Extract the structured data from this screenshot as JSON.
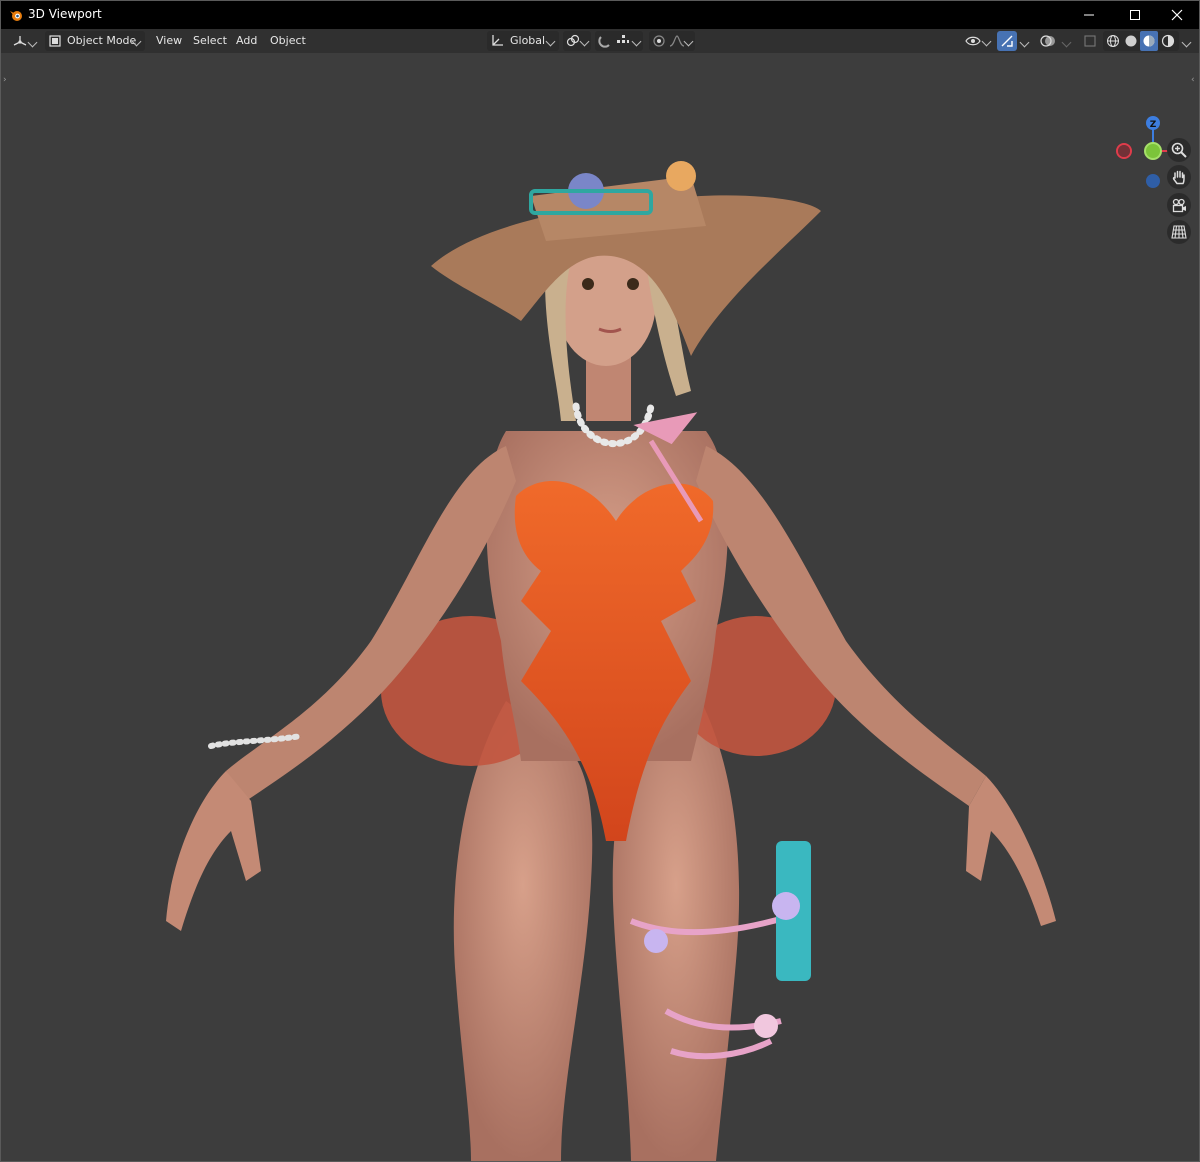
{
  "window": {
    "title": "3D Viewport",
    "controls": [
      "minimize",
      "maximize",
      "close"
    ]
  },
  "header": {
    "editor_type_icon": "viewport-editor-icon",
    "mode_label": "Object Mode",
    "menus": [
      "View",
      "Select",
      "Add",
      "Object"
    ],
    "transform_orientation": "Global",
    "right_icons": [
      "visibility-icon",
      "gizmo-icon",
      "overlay-icon",
      "xray-icon",
      "wireframe-shading-icon",
      "solid-shading-icon",
      "material-shading-icon",
      "rendered-shading-icon"
    ]
  },
  "navigation_gizmo": {
    "axes": [
      "Z",
      "X"
    ],
    "colors": {
      "x": "#e03c4b",
      "y": "#7cc43a",
      "z": "#3d7ee0"
    }
  },
  "navigation_buttons": [
    "zoom-icon",
    "pan-hand-icon",
    "camera-icon",
    "orthographic-grid-icon"
  ],
  "colors": {
    "viewport_bg": "#3d3d3d",
    "header_bg": "#303030",
    "titlebar_bg": "#000000",
    "swimsuit": "#e0531e",
    "hat": "#a97a5a",
    "skin": "#c98f78"
  }
}
